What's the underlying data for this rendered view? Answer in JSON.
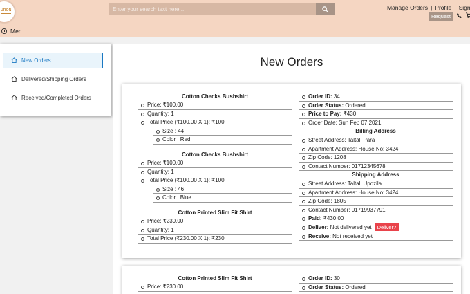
{
  "header": {
    "logo_text": "URON",
    "search_placeholder": "Enter your search text here...",
    "nav_links": [
      "Manage Orders",
      "Profile",
      "Sign O"
    ],
    "request_label": "Request",
    "men_label": "Men"
  },
  "sidebar": {
    "items": [
      {
        "label": "New Orders",
        "active": true
      },
      {
        "label": "Delivered/Shipping Orders",
        "active": false
      },
      {
        "label": "Received/Completed Orders",
        "active": false
      }
    ]
  },
  "page": {
    "title": "New Orders"
  },
  "orders": [
    {
      "products": [
        {
          "name": "Cotton Checks Bushshirt",
          "price": "Price: ₹100.00",
          "quantity": "Quantity: 1",
          "total": "Total Price (₹100.00 X 1): ₹100",
          "size": "Size : 44",
          "color": "Color : Red"
        },
        {
          "name": "Cotton Checks Bushshirt",
          "price": "Price: ₹100.00",
          "quantity": "Quantity: 1",
          "total": "Total Price (₹100.00 X 1): ₹100",
          "size": "Size : 46",
          "color": "Color : Blue"
        },
        {
          "name": "Cotton Printed Slim Fit Shirt",
          "price": "Price: ₹230.00",
          "quantity": "Quantity: 1",
          "total": "Total Price (₹230.00 X 1): ₹230"
        }
      ],
      "order_id_label": "Order ID:",
      "order_id": "34",
      "status_label": "Order Status:",
      "status": "Ordered",
      "pay_label": "Price to Pay:",
      "pay": "₹430",
      "date": "Order Date: Sun Feb 07 2021",
      "billing_title": "Billing Address",
      "billing_street": "Street Address: Taltali Para",
      "billing_apartment": "Apartment Address: House No: 3424",
      "billing_zip": "Zip Code: 1208",
      "billing_contact": "Contact Number: 01712345678",
      "shipping_title": "Shipping Address",
      "shipping_street": "Street Address: Taltali Upozila",
      "shipping_apartment": "Apartment Address: House No: 3424",
      "shipping_zip": "Zip Code: 1805",
      "shipping_contact": "Contact Number: 01719937791",
      "paid_label": "Paid:",
      "paid": "₹430.00",
      "deliver_label": "Deliver:",
      "deliver": "Not delivered yet",
      "deliver_button": "Deliver?",
      "receive_label": "Receive:",
      "receive": "Not received yet"
    },
    {
      "products": [
        {
          "name": "Cotton Printed Slim Fit Shirt",
          "price": "Price: ₹230.00"
        }
      ],
      "order_id_label": "Order ID:",
      "order_id": "30",
      "status_label": "Order Status:",
      "status": "Ordered"
    }
  ],
  "colors": {
    "header_bg": "#f5d6c2",
    "accent_blue": "#1a78c2",
    "deliver_red": "#e9434b"
  }
}
